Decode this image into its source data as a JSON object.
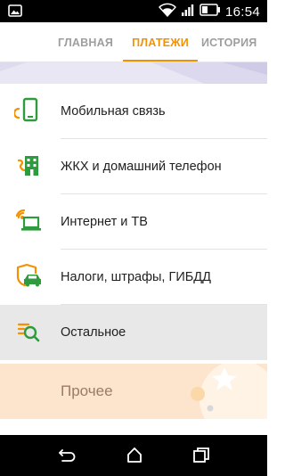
{
  "status_bar": {
    "time": "16:54",
    "icons": [
      "gallery-icon",
      "wifi-icon",
      "signal-icon",
      "battery-icon"
    ]
  },
  "tabs": [
    {
      "label": "ГЛАВНАЯ",
      "active": false
    },
    {
      "label": "ПЛАТЕЖИ",
      "active": true
    },
    {
      "label": "ИСТОРИЯ",
      "active": false
    }
  ],
  "menu": {
    "items": [
      {
        "label": "Мобильная связь",
        "icon": "mobile-phone-icon"
      },
      {
        "label": "ЖКХ и домашний телефон",
        "icon": "building-icon"
      },
      {
        "label": "Интернет и ТВ",
        "icon": "laptop-icon"
      },
      {
        "label": "Налоги, штрафы, ГИБДД",
        "icon": "car-shield-icon"
      },
      {
        "label": "Остальное",
        "icon": "search-list-icon",
        "selected": true
      }
    ]
  },
  "footer": {
    "section_label": "Прочее"
  },
  "colors": {
    "accent": "#f39200",
    "icon_orange": "#f39200",
    "icon_green": "#2e9b3e",
    "selected_row": "#e8e8e8",
    "footer_band": "#fde4cc"
  },
  "navigation": {
    "buttons": [
      "back-icon",
      "home-icon",
      "recent-apps-icon"
    ]
  }
}
